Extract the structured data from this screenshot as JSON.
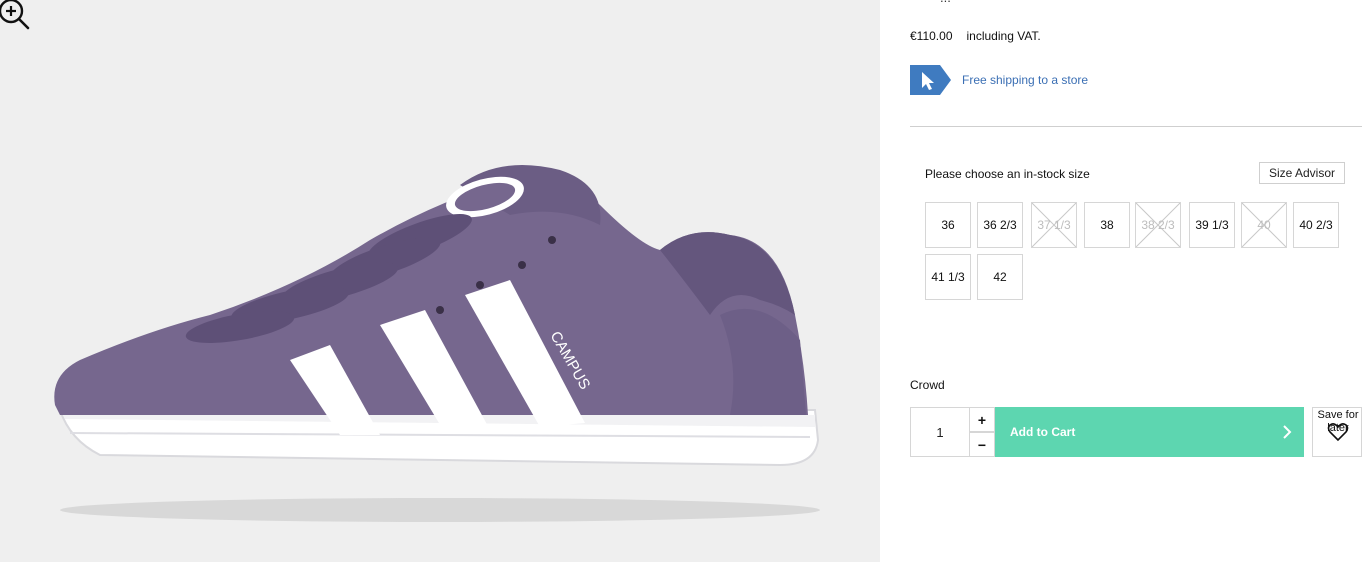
{
  "gallery": {
    "zoom_icon": "zoom-in-icon",
    "product_image": "purple-suede-sneaker",
    "shoe_side_text": "CAMPUS"
  },
  "product": {
    "cut_off_text": "...",
    "price": "€110.00",
    "vat_note": "including VAT.",
    "shipping_icon": "cursor-arrow-icon",
    "shipping_label": "Free shipping to a store"
  },
  "sizes": {
    "heading": "Please choose an in-stock size",
    "advisor_label": "Size Advisor",
    "options": [
      {
        "label": "36",
        "available": true
      },
      {
        "label": "36 2/3",
        "available": true
      },
      {
        "label": "37 1/3",
        "available": false
      },
      {
        "label": "38",
        "available": true
      },
      {
        "label": "38 2/3",
        "available": false
      },
      {
        "label": "39 1/3",
        "available": true
      },
      {
        "label": "40",
        "available": false
      },
      {
        "label": "40 2/3",
        "available": true
      },
      {
        "label": "41 1/3",
        "available": true
      },
      {
        "label": "42",
        "available": true
      }
    ]
  },
  "purchase": {
    "crowd_label": "Crowd",
    "quantity": "1",
    "plus_label": "+",
    "minus_label": "−",
    "add_to_cart_label": "Add to Cart",
    "save_for_later_label": "Save for later"
  },
  "colors": {
    "accent_green": "#5dd6b0",
    "link_blue": "#3b6fb4",
    "shoe_purple": "#76678e"
  }
}
